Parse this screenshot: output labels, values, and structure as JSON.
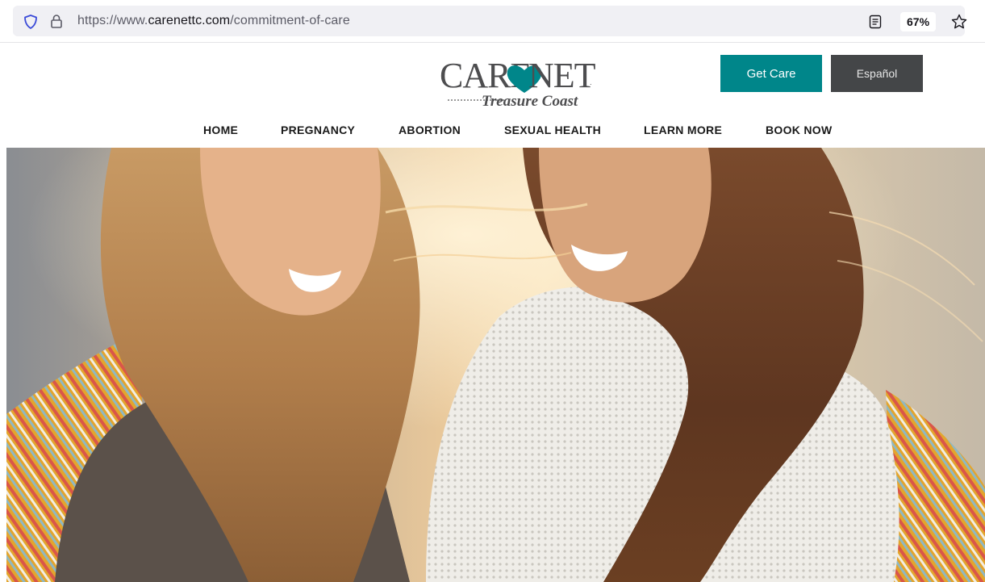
{
  "browser": {
    "url_prefix": "https://www.",
    "url_domain": "carenettc.com",
    "url_path": "/commitment-of-care",
    "zoom": "67%"
  },
  "logo": {
    "word_left": "CARE",
    "word_right": "NET",
    "trademark": ".",
    "tagline": "Treasure Coast"
  },
  "header": {
    "get_care_label": "Get Care",
    "espanol_label": "Español"
  },
  "nav": {
    "items": [
      "HOME",
      "PREGNANCY",
      "ABORTION",
      "SEXUAL HEALTH",
      "LEARN MORE",
      "BOOK NOW"
    ]
  },
  "colors": {
    "brand_teal": "#00868a",
    "secondary_button": "#444648",
    "logo_gray": "#4d4d4f"
  },
  "icons": {
    "shield": "tracking-protection-icon",
    "lock": "lock-icon",
    "reader": "reader-view-icon",
    "star": "bookmark-star-icon",
    "heart": "heart-logo-icon"
  }
}
